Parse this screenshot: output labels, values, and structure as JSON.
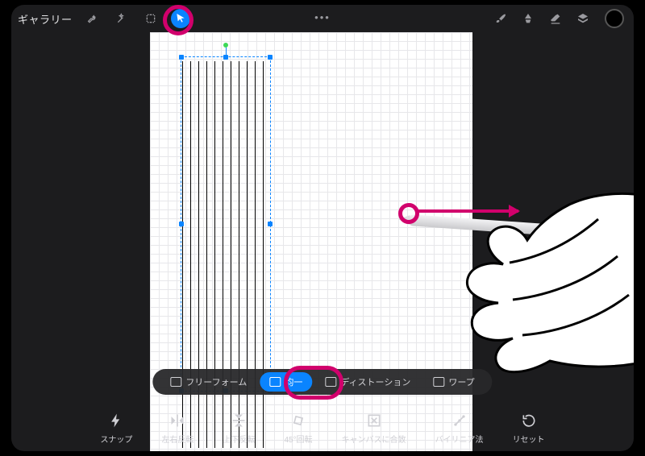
{
  "header": {
    "gallery_label": "ギャラリー",
    "tools": [
      {
        "name": "wrench-icon"
      },
      {
        "name": "wand-icon"
      },
      {
        "name": "selection-icon"
      },
      {
        "name": "cursor-icon",
        "active": true
      }
    ],
    "right_tools": [
      {
        "name": "brush-icon"
      },
      {
        "name": "smudge-icon"
      },
      {
        "name": "eraser-icon"
      },
      {
        "name": "layers-icon"
      }
    ]
  },
  "modes": [
    {
      "name": "mode-freeform",
      "label": "フリーフォーム",
      "active": false
    },
    {
      "name": "mode-uniform",
      "label": "均一",
      "active": true
    },
    {
      "name": "mode-distortion",
      "label": "ディストーション",
      "active": false
    },
    {
      "name": "mode-warp",
      "label": "ワープ",
      "active": false
    }
  ],
  "actions": [
    {
      "name": "action-snap",
      "label": "スナップ",
      "icon": "bolt-icon"
    },
    {
      "name": "action-flip-h",
      "label": "左右反転",
      "icon": "flip-h-icon"
    },
    {
      "name": "action-flip-v",
      "label": "上下反転",
      "icon": "flip-v-icon"
    },
    {
      "name": "action-rotate45",
      "label": "45°回転",
      "icon": "rotate-icon"
    },
    {
      "name": "action-fit",
      "label": "キャンバスに合致",
      "icon": "fit-icon"
    },
    {
      "name": "action-bilinear",
      "label": "バイリニア法",
      "icon": "interpolation-icon"
    },
    {
      "name": "action-reset",
      "label": "リセット",
      "icon": "reset-icon"
    }
  ]
}
